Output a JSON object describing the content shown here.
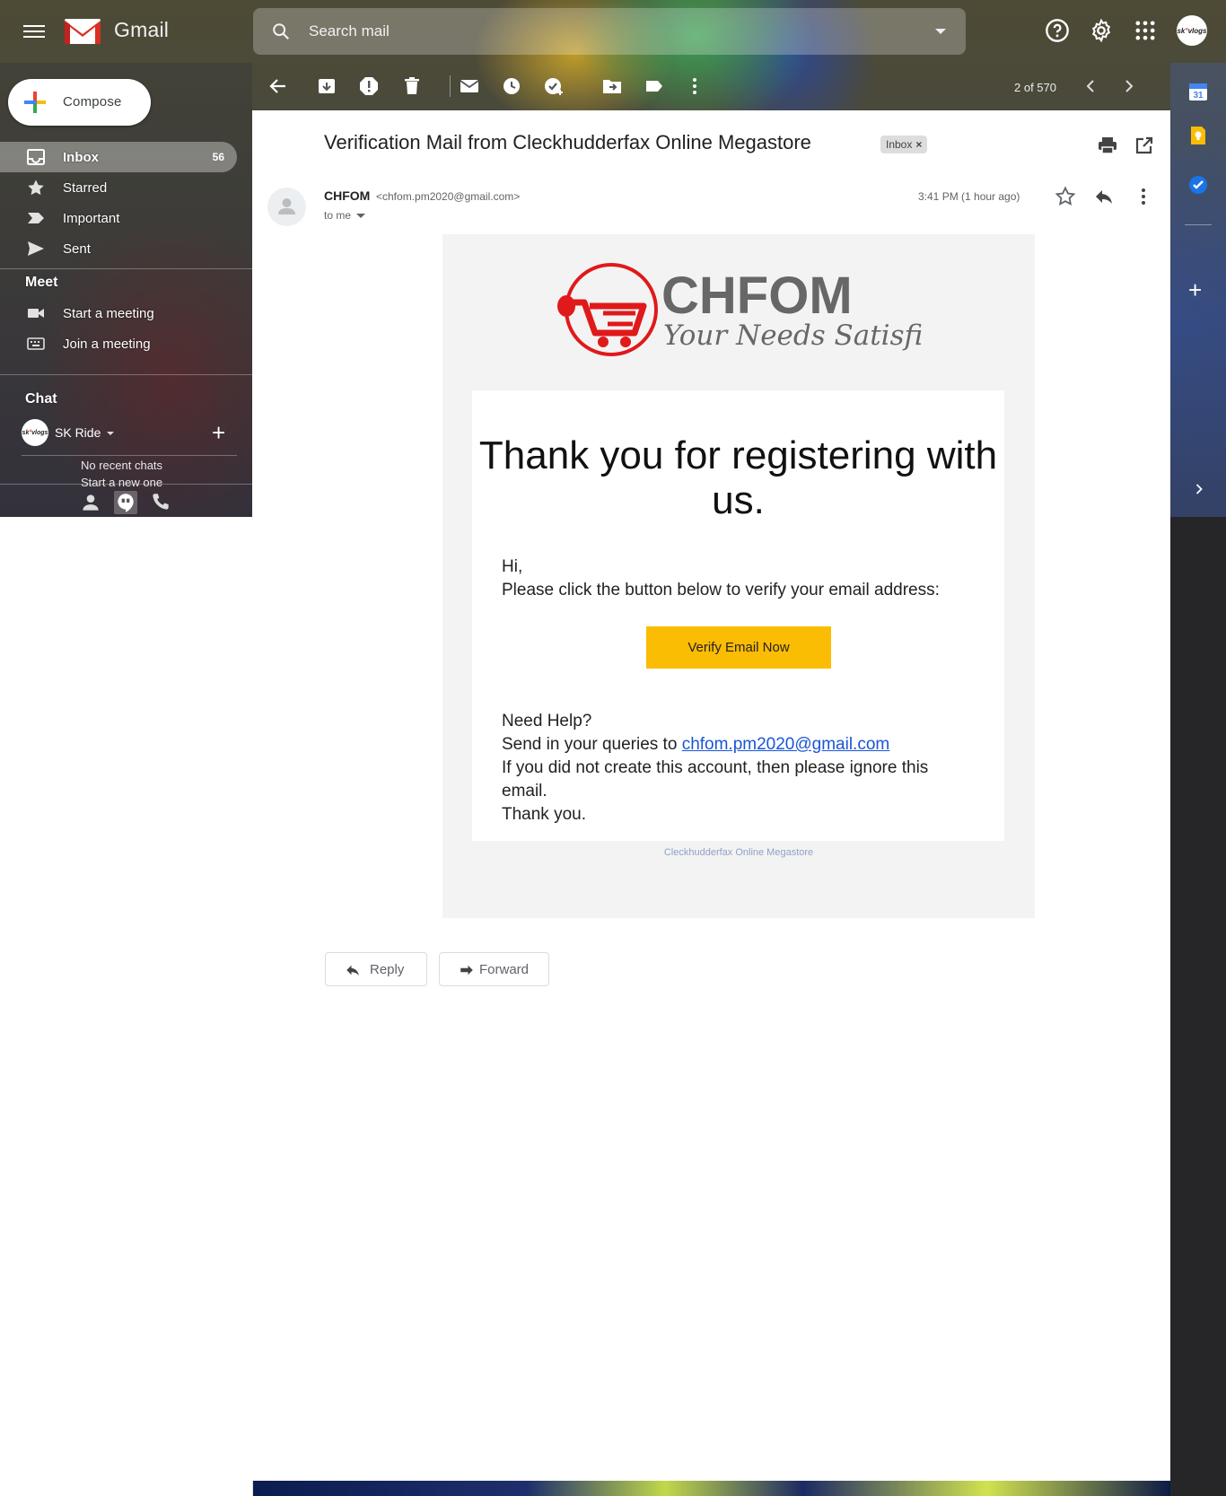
{
  "app": {
    "name": "Gmail",
    "search_placeholder": "Search mail"
  },
  "account": {
    "avatar_text_a": "sk",
    "avatar_text_b": "vlogs"
  },
  "nav": {
    "compose_label": "Compose",
    "items": [
      {
        "label": "Inbox",
        "count": "56",
        "icon": "inbox-icon"
      },
      {
        "label": "Starred",
        "icon": "star-icon"
      },
      {
        "label": "Important",
        "icon": "important-icon"
      },
      {
        "label": "Sent",
        "icon": "send-icon"
      }
    ],
    "meet_heading": "Meet",
    "meet_items": [
      {
        "label": "Start a meeting",
        "icon": "video-icon"
      },
      {
        "label": "Join a meeting",
        "icon": "keyboard-icon"
      }
    ],
    "chat_heading": "Chat",
    "chat_user": "SK Ride",
    "no_recent": "No recent chats",
    "start_new": "Start a new one"
  },
  "toolbar": {
    "pager": "2 of 570"
  },
  "message": {
    "subject": "Verification Mail from Cleckhudderfax Online Megastore",
    "label_chip": "Inbox",
    "label_chip_remove": "×",
    "sender_name": "CHFOM",
    "sender_email": "<chfom.pm2020@gmail.com>",
    "recipient": "to me",
    "time": "3:41 PM (1 hour ago)"
  },
  "email_body": {
    "logo_title": "CHFOM",
    "logo_tagline": "Your Needs Satisfied",
    "heading": "Thank you for registering with us.",
    "greeting": "Hi,",
    "instruction": "Please click the button below to verify your email address:",
    "button_label": "Verify Email Now",
    "help_heading": "Need Help?",
    "queries_prefix": "Send in your queries to ",
    "queries_email": "chfom.pm2020@gmail.com",
    "ignore_line": "If you did not create this account, then please ignore this email.",
    "thanks_line": "Thank you.",
    "footer": "Cleckhudderfax Online Megastore"
  },
  "actions": {
    "reply_label": "Reply",
    "forward_label": "Forward"
  },
  "side_panel": {
    "calendar_day": "31"
  },
  "colors": {
    "accent_yellow": "#fbbc04",
    "logo_red": "#e0191b",
    "logo_gray": "#676767",
    "link_blue": "#1a55d6"
  }
}
